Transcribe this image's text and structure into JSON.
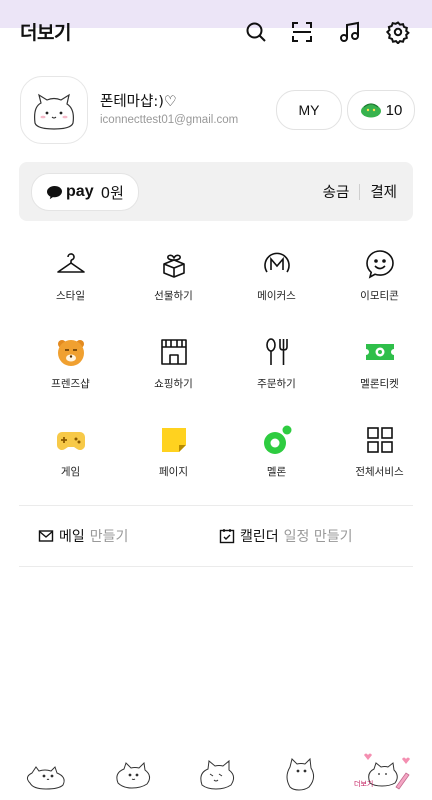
{
  "header": {
    "title": "더보기",
    "icons": [
      "search-icon",
      "scan-icon",
      "music-icon",
      "settings-icon"
    ]
  },
  "profile": {
    "name": "폰테마샵:)♡",
    "email": "iconnecttest01@gmail.com",
    "my_label": "MY",
    "coin_count": "10"
  },
  "pay": {
    "brand": "pay",
    "balance": "0원",
    "send_label": "송금",
    "payment_label": "결제"
  },
  "grid": {
    "items": [
      {
        "label": "스타일",
        "icon": "hanger-icon"
      },
      {
        "label": "선물하기",
        "icon": "gift-icon"
      },
      {
        "label": "메이커스",
        "icon": "makers-icon"
      },
      {
        "label": "이모티콘",
        "icon": "emoticon-icon"
      },
      {
        "label": "프렌즈샵",
        "icon": "friends-shop-icon"
      },
      {
        "label": "쇼핑하기",
        "icon": "shop-icon"
      },
      {
        "label": "주문하기",
        "icon": "order-icon"
      },
      {
        "label": "멜론티켓",
        "icon": "ticket-icon"
      },
      {
        "label": "게임",
        "icon": "game-icon"
      },
      {
        "label": "페이지",
        "icon": "page-icon"
      },
      {
        "label": "멜론",
        "icon": "melon-icon"
      },
      {
        "label": "전체서비스",
        "icon": "all-services-icon"
      }
    ]
  },
  "links": {
    "mail_strong": "메일",
    "mail_soft": "만들기",
    "calendar_strong": "캘린더",
    "calendar_soft": "일정 만들기"
  },
  "bottom_nav": {
    "tabs": [
      "friends-tab-icon",
      "chats-tab-icon",
      "view-tab-icon",
      "shopping-tab-icon",
      "more-tab-icon"
    ],
    "active_label": "더보기"
  },
  "colors": {
    "status_bar": "#ece5f7",
    "pay_bg": "#f1f1f1",
    "coin_green": "#37b24d",
    "ticket_green": "#2fbf4a",
    "melon_green": "#2ecc40",
    "friends_orange": "#f0a030",
    "page_yellow": "#ffd21f",
    "game_yellow": "#f7c948",
    "accent_pink": "#f4a6c4"
  }
}
